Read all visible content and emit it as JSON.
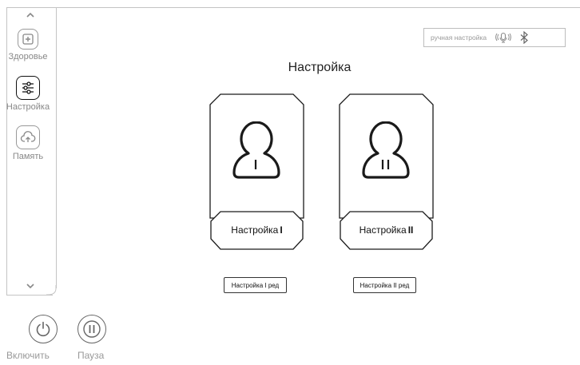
{
  "sidebar": {
    "items": [
      {
        "label": "Здоровье",
        "icon": "plus-box-icon"
      },
      {
        "label": "Настройка",
        "icon": "sliders-icon"
      },
      {
        "label": "Память",
        "icon": "cloud-upload-icon"
      }
    ],
    "scroll_up_icon": "chevron-up-icon",
    "scroll_down_icon": "chevron-down-icon"
  },
  "status": {
    "mode_text": "ручная настройка",
    "voice_icon": "microphone-icon",
    "bluetooth_icon": "bluetooth-icon"
  },
  "main": {
    "title": "Настройка",
    "profiles": [
      {
        "label": "Настройка",
        "numeral": "I",
        "edit_label": "Настройка I ред"
      },
      {
        "label": "Настройка",
        "numeral": "II",
        "edit_label": "Настройка II ред"
      }
    ]
  },
  "controls": {
    "power_label": "Включить",
    "pause_label": "Пауза"
  },
  "colors": {
    "frame": "#c4c4c4",
    "card_stroke": "#1a1a1a",
    "muted_text": "#999999"
  }
}
